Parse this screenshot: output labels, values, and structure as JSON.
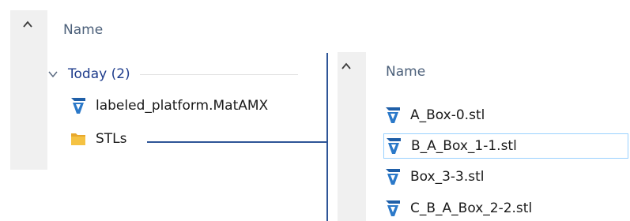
{
  "left_panel": {
    "column_header": "Name",
    "group": {
      "label": "Today (2)",
      "expanded": true
    },
    "items": [
      {
        "name": "labeled_platform.MatAMX",
        "icon": "matamx-file-icon"
      },
      {
        "name": "STLs",
        "icon": "folder-icon"
      }
    ]
  },
  "right_panel": {
    "column_header": "Name",
    "items": [
      {
        "name": "A_Box-0.stl",
        "icon": "stl-file-icon",
        "selected": false
      },
      {
        "name": "B_A_Box_1-1.stl",
        "icon": "stl-file-icon",
        "selected": true
      },
      {
        "name": "Box_3-3.stl",
        "icon": "stl-file-icon",
        "selected": false
      },
      {
        "name": "C_B_A_Box_2-2.stl",
        "icon": "stl-file-icon",
        "selected": false
      }
    ]
  },
  "colors": {
    "group_label": "#1e3c8c",
    "header_text": "#4c607a",
    "connector": "#2e5597",
    "selection_border": "#99d1ff",
    "folder": "#f5c242"
  }
}
